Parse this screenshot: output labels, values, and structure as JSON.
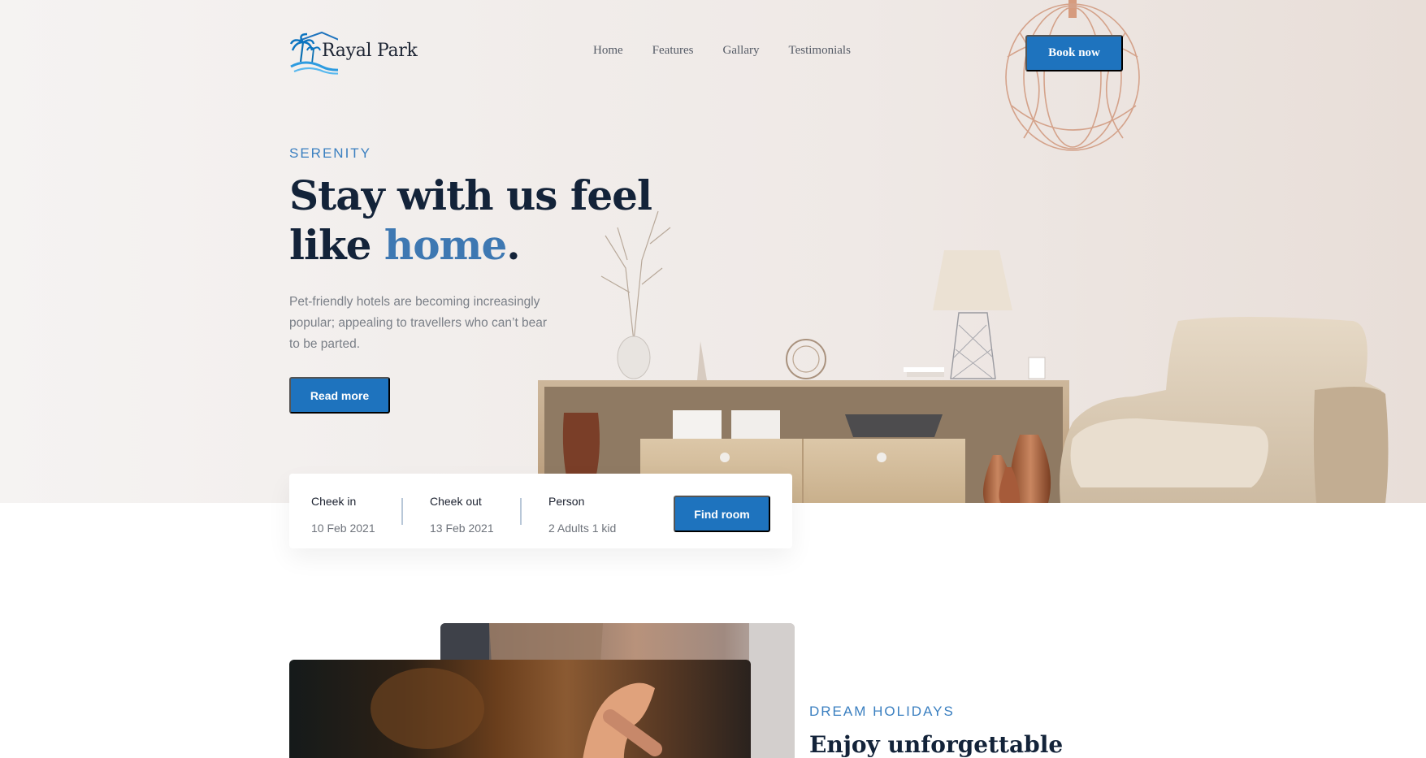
{
  "brand": {
    "name": "Rayal Park"
  },
  "nav": {
    "items": [
      "Home",
      "Features",
      "Gallary",
      "Testimonials"
    ],
    "cta": "Book now"
  },
  "hero": {
    "eyebrow": "SERENITY",
    "headline_part1": "Stay with us feel like ",
    "headline_accent": "home",
    "headline_end": ".",
    "description": "Pet-friendly hotels are becoming increasingly popular; appealing to travellers who can’t bear to be parted.",
    "button": "Read more"
  },
  "booking": {
    "checkin": {
      "label": "Cheek in",
      "value": "10 Feb 2021"
    },
    "checkout": {
      "label": "Cheek out",
      "value": "13 Feb 2021"
    },
    "person": {
      "label": "Person",
      "value": "2 Adults 1 kid"
    },
    "button": "Find room"
  },
  "section": {
    "eyebrow": "DREAM HOLIDAYS",
    "title": "Enjoy unforgettable"
  },
  "colors": {
    "primary": "#1e73be",
    "accent_text": "#3e78b2",
    "heading": "#132339"
  },
  "icons": [
    "palm-tree-logo-icon",
    "house-roof-icon",
    "wave-icon"
  ]
}
